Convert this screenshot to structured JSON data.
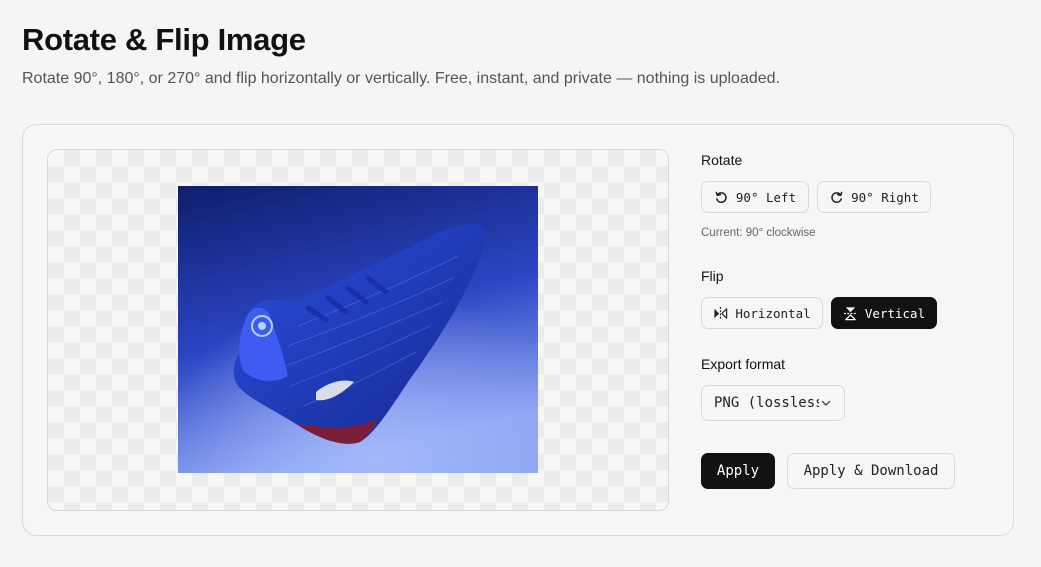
{
  "header": {
    "title": "Rotate & Flip Image",
    "subtitle": "Rotate 90°, 180°, or 270° and flip horizontally or vertically. Free, instant, and private — nothing is uploaded."
  },
  "rotate": {
    "label": "Rotate",
    "left_label": "90° Left",
    "right_label": "90° Right",
    "current": "Current: 90° clockwise"
  },
  "flip": {
    "label": "Flip",
    "horizontal_label": "Horizontal",
    "vertical_label": "Vertical",
    "active": "vertical"
  },
  "export": {
    "label": "Export format",
    "selected": "PNG (lossless)"
  },
  "actions": {
    "apply_label": "Apply",
    "apply_download_label": "Apply & Download"
  },
  "colors": {
    "accent_dark": "#121212",
    "photo_blue": "#2e46c8"
  }
}
